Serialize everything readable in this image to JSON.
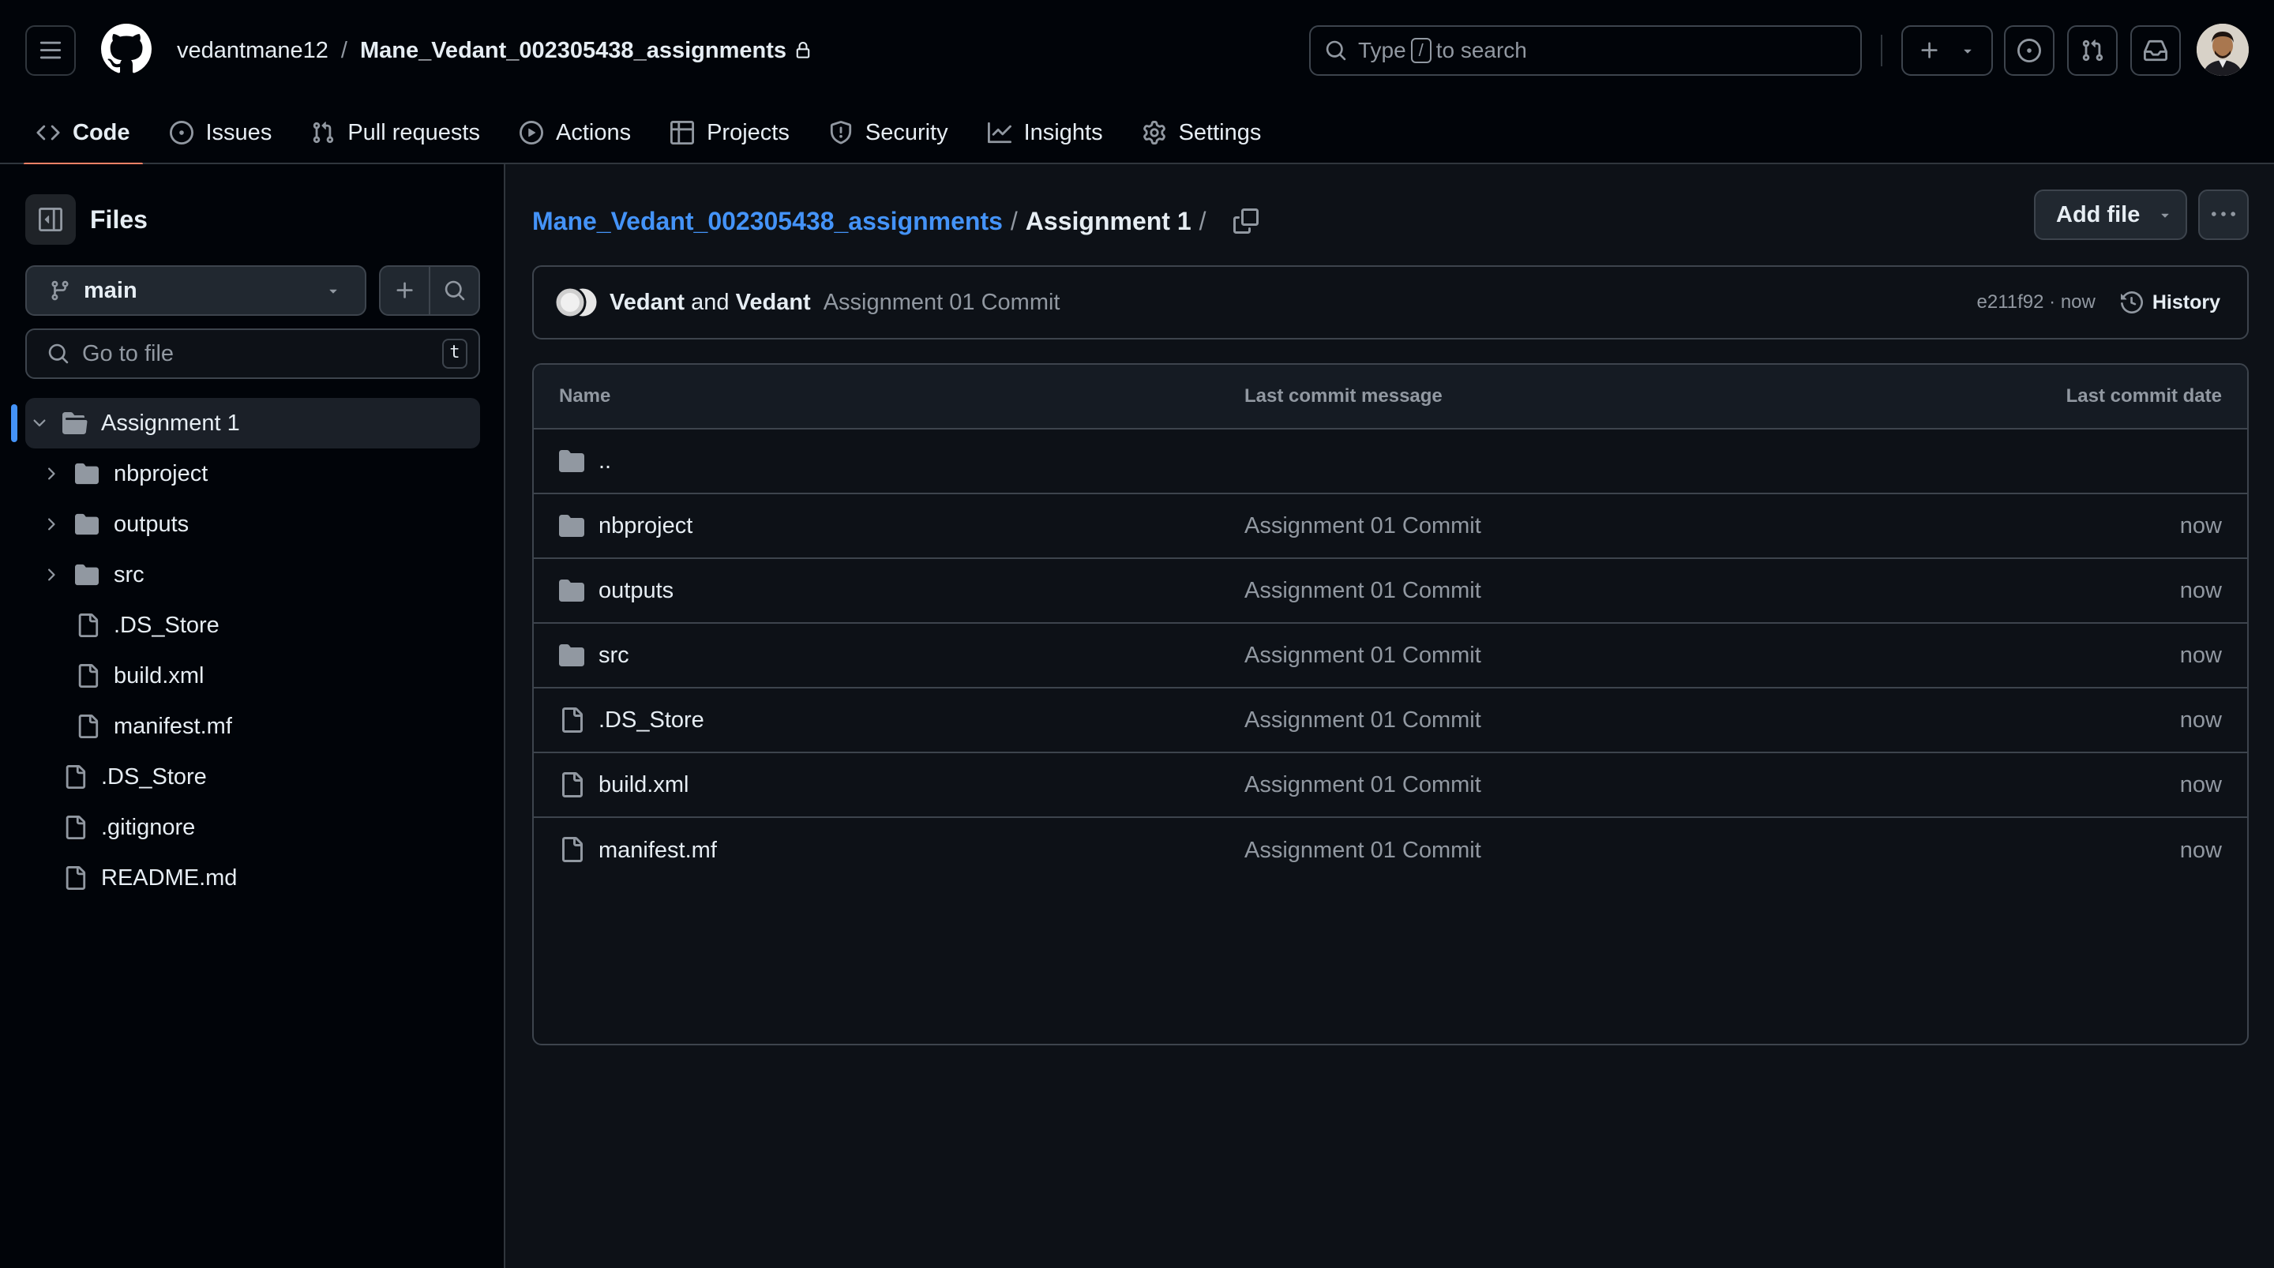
{
  "header": {
    "owner": "vedantmane12",
    "separator": "/",
    "repo": "Mane_Vedant_002305438_assignments",
    "search": {
      "prefix": "Type",
      "key": "/",
      "suffix": "to search"
    }
  },
  "nav": {
    "tabs": [
      {
        "label": "Code",
        "icon": "code-icon",
        "active": true
      },
      {
        "label": "Issues",
        "icon": "issue-opened-icon"
      },
      {
        "label": "Pull requests",
        "icon": "git-pull-request-icon"
      },
      {
        "label": "Actions",
        "icon": "play-icon"
      },
      {
        "label": "Projects",
        "icon": "table-icon"
      },
      {
        "label": "Security",
        "icon": "shield-icon"
      },
      {
        "label": "Insights",
        "icon": "graph-icon"
      },
      {
        "label": "Settings",
        "icon": "gear-icon"
      }
    ]
  },
  "sidebar": {
    "title": "Files",
    "branch": "main",
    "goto_placeholder": "Go to file",
    "goto_key": "t",
    "tree": [
      {
        "label": "Assignment 1",
        "type": "folder-open",
        "level": 0,
        "selected": true,
        "expanded": true
      },
      {
        "label": "nbproject",
        "type": "folder",
        "level": 1
      },
      {
        "label": "outputs",
        "type": "folder",
        "level": 1
      },
      {
        "label": "src",
        "type": "folder",
        "level": 1
      },
      {
        "label": ".DS_Store",
        "type": "file",
        "level": 1
      },
      {
        "label": "build.xml",
        "type": "file",
        "level": 1
      },
      {
        "label": "manifest.mf",
        "type": "file",
        "level": 1
      },
      {
        "label": ".DS_Store",
        "type": "file",
        "level": 0
      },
      {
        "label": ".gitignore",
        "type": "file",
        "level": 0
      },
      {
        "label": "README.md",
        "type": "file",
        "level": 0
      }
    ]
  },
  "main": {
    "path_repo": "Mane_Vedant_002305438_assignments",
    "path_sep": "/",
    "path_current": "Assignment 1",
    "path_trailing": "/",
    "add_file": "Add file",
    "commit": {
      "author1": "Vedant",
      "and": "and",
      "author2": "Vedant",
      "message": "Assignment 01 Commit",
      "meta": "e211f92 · now",
      "history": "History"
    },
    "table": {
      "headers": {
        "name": "Name",
        "message": "Last commit message",
        "date": "Last commit date"
      },
      "rows": [
        {
          "name": "..",
          "type": "folder",
          "message": "",
          "date": ""
        },
        {
          "name": "nbproject",
          "type": "folder",
          "message": "Assignment 01 Commit",
          "date": "now"
        },
        {
          "name": "outputs",
          "type": "folder",
          "message": "Assignment 01 Commit",
          "date": "now"
        },
        {
          "name": "src",
          "type": "folder",
          "message": "Assignment 01 Commit",
          "date": "now"
        },
        {
          "name": ".DS_Store",
          "type": "file",
          "message": "Assignment 01 Commit",
          "date": "now"
        },
        {
          "name": "build.xml",
          "type": "file",
          "message": "Assignment 01 Commit",
          "date": "now"
        },
        {
          "name": "manifest.mf",
          "type": "file",
          "message": "Assignment 01 Commit",
          "date": "now"
        }
      ]
    }
  },
  "colors": {
    "background": "#0d1117",
    "header": "#010409",
    "border": "#30363d",
    "link": "#4493f8",
    "active_tab": "#f78166",
    "muted": "#9198a1",
    "text": "#e6edf3"
  }
}
